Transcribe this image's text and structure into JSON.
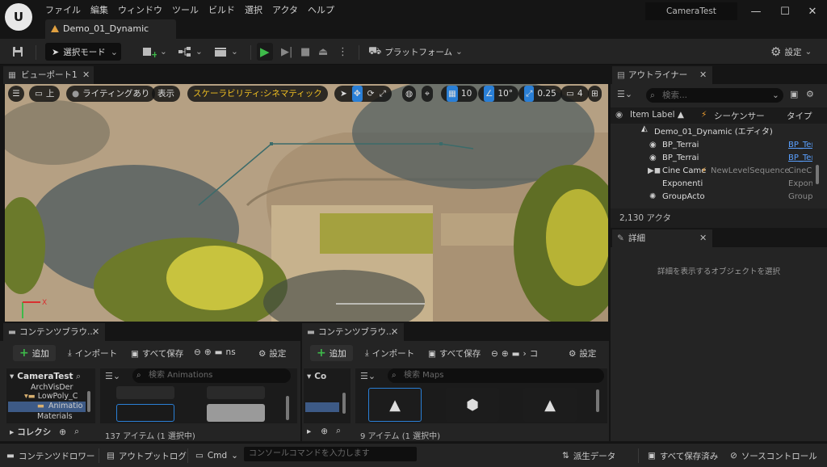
{
  "app": {
    "menu": [
      "ファイル",
      "編集",
      "ウィンドウ",
      "ツール",
      "ビルド",
      "選択",
      "アクタ",
      "ヘルプ"
    ],
    "project_title": "CameraTest",
    "document_tab": "Demo_01_Dynamic"
  },
  "toolbar": {
    "mode_label": "選択モード",
    "platform_label": "プラットフォーム",
    "settings_label": "設定"
  },
  "viewport": {
    "tab_label": "ビューポート1",
    "view_label": "上",
    "lighting_label": "ライティングあり",
    "show_label": "表示",
    "scalability_label": "スケーラビリティ:シネマティック",
    "grid_snap": "10",
    "rotation_snap": "10°",
    "scale_snap": "0.25",
    "camera_speed": "4",
    "axis_x": "X"
  },
  "outliner": {
    "tab_label": "アウトライナー",
    "search_placeholder": "検索...",
    "columns": {
      "label": "Item Label ▲",
      "sequencer": "シーケンサー",
      "type": "タイプ"
    },
    "root_label": "Demo_01_Dynamic (エディタ)",
    "rows": [
      {
        "name": "BP_Terrai",
        "sequencer": "",
        "type": "BP_Terra"
      },
      {
        "name": "BP_Terrai",
        "sequencer": "",
        "type": "BP_Terra"
      },
      {
        "name": "Cine Came",
        "sequencer": "NewLevelSequence",
        "type": "CineCa"
      },
      {
        "name": "Exponenti",
        "sequencer": "",
        "type": "Expone"
      },
      {
        "name": "GroupActo",
        "sequencer": "",
        "type": "GroupA"
      }
    ],
    "actor_count": "2,130 アクタ"
  },
  "details": {
    "tab_label": "詳細",
    "empty_text": "詳細を表示するオブジェクトを選択"
  },
  "content_browser_1": {
    "tab_label": "コンテンツブラウ...",
    "add_label": "追加",
    "import_label": "インポート",
    "save_all_label": "すべて保存",
    "path_tail": "ns",
    "settings_label": "設定",
    "root_folder": "CameraTest",
    "tree_items": [
      "ArchVisDer",
      "LowPoly_C",
      "Animatio",
      "Materials"
    ],
    "collections_label": "コレクシ",
    "search_placeholder": "検索 Animations",
    "item_count": "137 アイテム (1 選択中)"
  },
  "content_browser_2": {
    "tab_label": "コンテンツブラウ...",
    "add_label": "追加",
    "import_label": "インポート",
    "save_all_label": "すべて保存",
    "path_tail": "コ",
    "settings_label": "設定",
    "root_folder": "Co",
    "search_placeholder": "検索 Maps",
    "item_count": "9 アイテム (1 選択中)"
  },
  "statusbar": {
    "content_drawer": "コンテンツドロワー",
    "output_log": "アウトプットログ",
    "cmd_label": "Cmd",
    "cmd_placeholder": "コンソールコマンドを入力します",
    "derived_data": "派生データ",
    "all_saved": "すべて保存済み",
    "source_control": "ソースコントロール"
  }
}
